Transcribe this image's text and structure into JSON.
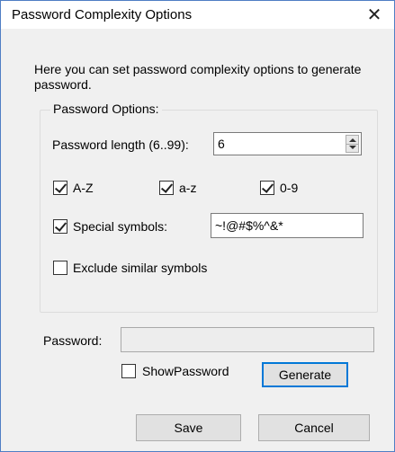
{
  "window": {
    "title": "Password Complexity Options",
    "close_glyph": "✕"
  },
  "intro_text": "Here you can set password complexity options to generate password.",
  "options": {
    "group_label": "Password Options:",
    "length_label": "Password length (6..99):",
    "length_value": "6",
    "uppercase": {
      "label": "A-Z",
      "checked": true
    },
    "lowercase": {
      "label": "a-z",
      "checked": true
    },
    "digits": {
      "label": "0-9",
      "checked": true
    },
    "special": {
      "label": "Special symbols:",
      "checked": true,
      "value": "~!@#$%^&*"
    },
    "exclude_similar": {
      "label": "Exclude similar symbols",
      "checked": false
    }
  },
  "password": {
    "label": "Password:",
    "value": "",
    "show_password": {
      "label": "ShowPassword",
      "checked": false
    },
    "generate_label": "Generate"
  },
  "buttons": {
    "save": "Save",
    "cancel": "Cancel"
  },
  "colors": {
    "accent": "#0078d7",
    "window_border": "#4f7ec4"
  }
}
